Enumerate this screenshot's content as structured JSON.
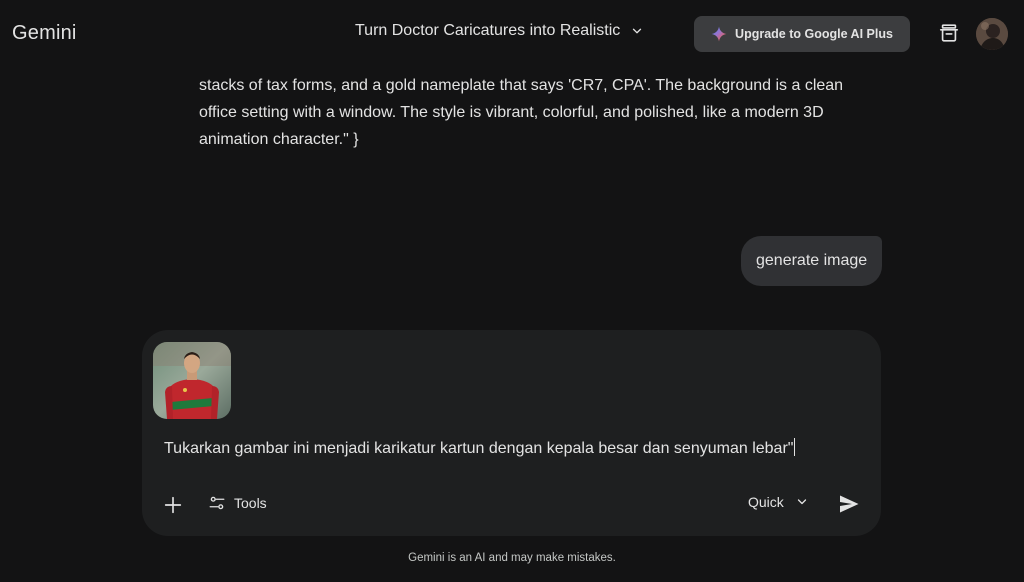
{
  "header": {
    "app_name": "Gemini",
    "conversation_title": "Turn Doctor Caricatures into Realistic",
    "upgrade_label": "Upgrade to Google AI Plus"
  },
  "response": {
    "lines": [
      "stacks of tax forms, and a gold nameplate that says 'CR7, CPA'. The background is a clean",
      "office setting with a window. The style is vibrant, colorful, and polished, like a modern 3D",
      "animation character.\" }"
    ]
  },
  "user_message": {
    "text": "generate image"
  },
  "composer": {
    "prompt_value": "Tukarkan gambar ini menjadi karikatur kartun dengan kepala besar dan senyuman lebar\"",
    "tools_label": "Tools",
    "mode_label": "Quick"
  },
  "footer": {
    "disclaimer": "Gemini is an AI and may make mistakes."
  },
  "icons": {
    "sparkle": "sparkle-icon",
    "chevron": "chevron-down-icon",
    "bin": "temporary-chat-icon",
    "add": "plus-icon",
    "tools": "tune-icon",
    "send": "send-icon"
  },
  "colors": {
    "background": "#131314",
    "card": "#1e1f20",
    "bubble": "#303134",
    "button": "#3c3d3f",
    "text": "#e3e3e3"
  }
}
